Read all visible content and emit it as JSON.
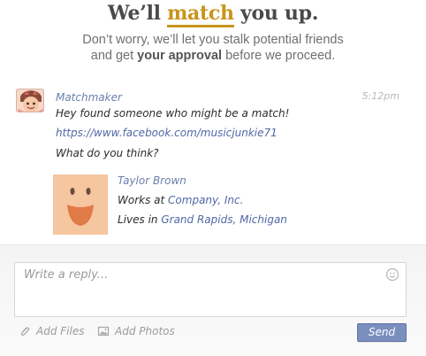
{
  "header": {
    "title_before": "We’ll",
    "title_highlight": "match",
    "title_after": "you up.",
    "subtitle_line1": "Don’t worry, we’ll let you stalk potential friends",
    "subtitle_line2_before": "and get",
    "subtitle_line2_bold": "your approval",
    "subtitle_line2_after": "before we proceed."
  },
  "message": {
    "sender": "Matchmaker",
    "time": "5:12pm",
    "text1": "Hey found someone who might be a match!",
    "link": "https://www.facebook.com/musicjunkie71",
    "text2": "What do you think?",
    "card": {
      "name": "Taylor Brown",
      "works_prefix": "Works at",
      "company": "Company, Inc.",
      "lives_prefix": "Lives in",
      "location": "Grand Rapids, Michigan"
    }
  },
  "composer": {
    "placeholder": "Write a reply...",
    "add_files": "Add Files",
    "add_photos": "Add Photos",
    "send": "Send",
    "emoji_icon": "smiley-icon",
    "attach_icon": "paperclip-icon",
    "photo_icon": "photo-icon"
  },
  "colors": {
    "accent": "#c8941b",
    "link": "#5168a6",
    "send_button": "#7b8fbf"
  }
}
